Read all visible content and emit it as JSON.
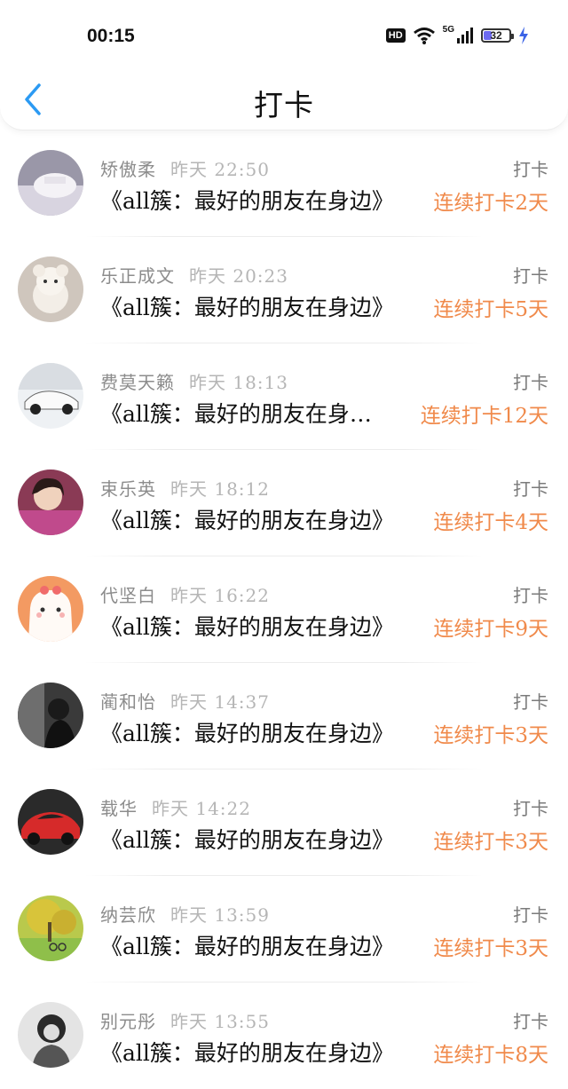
{
  "status_bar": {
    "time": "00:15",
    "hd_label": "HD",
    "network": "5G",
    "battery": "32"
  },
  "page": {
    "title": "打卡"
  },
  "checkins": [
    {
      "name": "矫傲柔",
      "time": "昨天 22:50",
      "type": "打卡",
      "book": "《all簇：最好的朋友在身边》",
      "streak": "连续打卡2天"
    },
    {
      "name": "乐正成文",
      "time": "昨天 20:23",
      "type": "打卡",
      "book": "《all簇：最好的朋友在身边》",
      "streak": "连续打卡5天"
    },
    {
      "name": "费莫天籁",
      "time": "昨天 18:13",
      "type": "打卡",
      "book": "《all簇：最好的朋友在身…",
      "streak": "连续打卡12天"
    },
    {
      "name": "束乐英",
      "time": "昨天 18:12",
      "type": "打卡",
      "book": "《all簇：最好的朋友在身边》",
      "streak": "连续打卡4天"
    },
    {
      "name": "代坚白",
      "time": "昨天 16:22",
      "type": "打卡",
      "book": "《all簇：最好的朋友在身边》",
      "streak": "连续打卡9天"
    },
    {
      "name": "蔺和怡",
      "time": "昨天 14:37",
      "type": "打卡",
      "book": "《all簇：最好的朋友在身边》",
      "streak": "连续打卡3天"
    },
    {
      "name": "载华",
      "time": "昨天 14:22",
      "type": "打卡",
      "book": "《all簇：最好的朋友在身边》",
      "streak": "连续打卡3天"
    },
    {
      "name": "纳芸欣",
      "time": "昨天 13:59",
      "type": "打卡",
      "book": "《all簇：最好的朋友在身边》",
      "streak": "连续打卡3天"
    },
    {
      "name": "别元彤",
      "time": "昨天 13:55",
      "type": "打卡",
      "book": "《all簇：最好的朋友在身边》",
      "streak": "连续打卡8天"
    }
  ],
  "colors": {
    "streak": "#f08a4b",
    "back_arrow": "#2b9af3",
    "name": "#8c8c8c",
    "time": "#b5b5b5"
  },
  "icons": [
    "back-arrow-icon",
    "wifi-icon",
    "signal-icon",
    "battery-icon",
    "charging-icon"
  ]
}
